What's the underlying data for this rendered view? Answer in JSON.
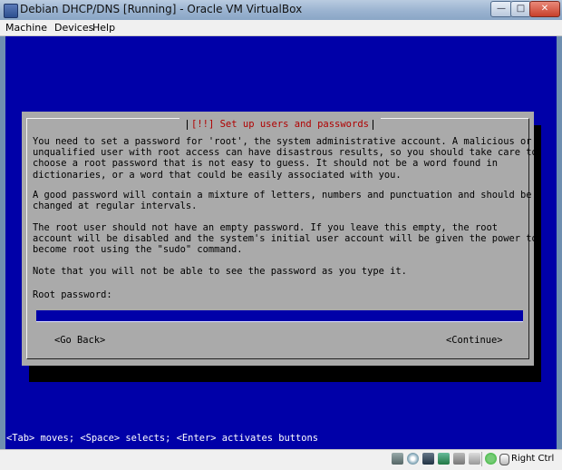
{
  "window": {
    "title": "Debian DHCP/DNS [Running] - Oracle VM VirtualBox",
    "controls": {
      "minimize": "—",
      "maximize": "□",
      "close": "✕"
    }
  },
  "menu": {
    "items": [
      "Machine",
      "Devices",
      "Help"
    ]
  },
  "installer": {
    "dialog_title": "[!!] Set up users and passwords",
    "paragraphs": [
      "You need to set a password for 'root', the system administrative account. A malicious or\nunqualified user with root access can have disastrous results, so you should take care to\nchoose a root password that is not easy to guess. It should not be a word found in\ndictionaries, or a word that could be easily associated with you.",
      "A good password will contain a mixture of letters, numbers and punctuation and should be\nchanged at regular intervals.",
      "The root user should not have an empty password. If you leave this empty, the root\naccount will be disabled and the system's initial user account will be given the power to\nbecome root using the \"sudo\" command.",
      "Note that you will not be able to see the password as you type it."
    ],
    "field_label": "Root password:",
    "password_value": "",
    "go_back_label": "<Go Back>",
    "continue_label": "<Continue>",
    "key_hint": "<Tab> moves; <Space> selects; <Enter> activates buttons"
  },
  "statusbar": {
    "icons": [
      "hard-disk-icon",
      "optical-drive-icon",
      "floppy-icon",
      "network-icon",
      "usb-icon",
      "shared-folders-icon",
      "mouse-integration-icon",
      "mouse-capture-icon"
    ],
    "host_key_label": "Right Ctrl"
  },
  "colors": {
    "screen_background": "#0000a8",
    "dialog_background": "#aaaaaa",
    "dialog_title": "#b00000"
  }
}
